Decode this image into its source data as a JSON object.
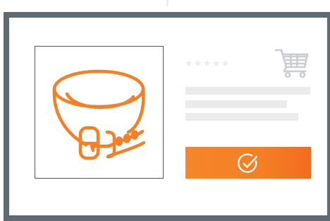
{
  "product": {
    "image_icon": "collar-icon",
    "rating": {
      "stars": 5,
      "filled": 0,
      "star_icon": "star-icon"
    }
  },
  "cart": {
    "icon": "shopping-cart-icon"
  },
  "description_placeholder_lines": 3,
  "confirm_button": {
    "icon": "check-circle-icon"
  },
  "colors": {
    "frame": "#5e6a74",
    "accent": "#f47f25",
    "placeholder": "#ebebec",
    "muted_icon": "#c9cdd1"
  }
}
